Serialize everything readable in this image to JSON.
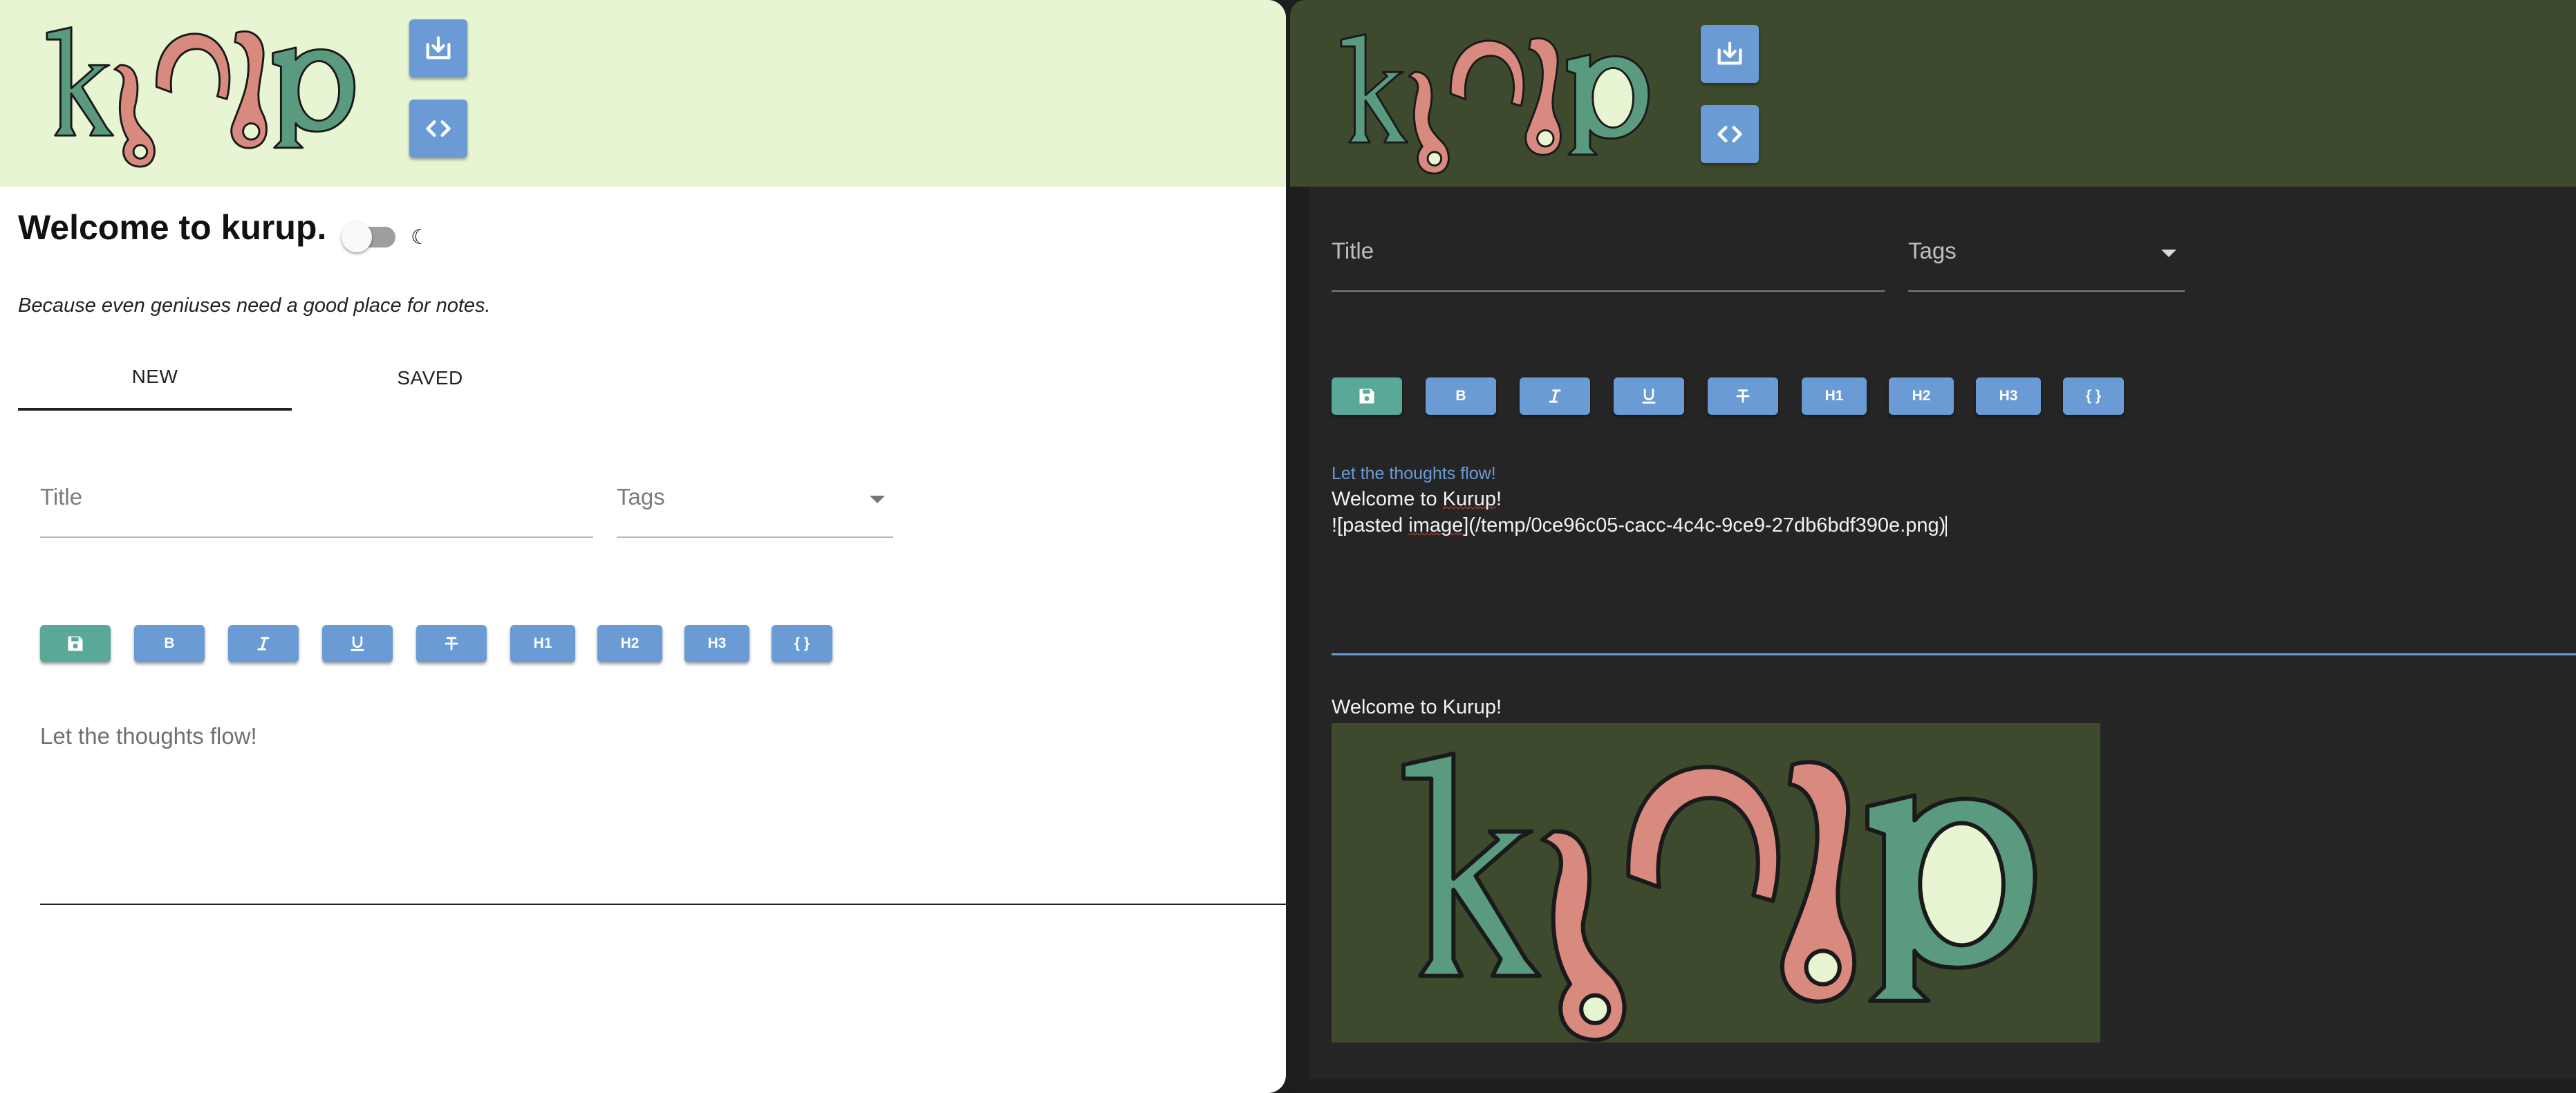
{
  "light": {
    "header": {
      "logo_alt": "kurup",
      "download_button_icon": "download-icon",
      "code_button_icon": "code-brackets-icon"
    },
    "welcome": "Welcome to kurup.",
    "theme_toggle": {
      "state": "off",
      "icon": "moon-icon"
    },
    "tagline": "Because even geniuses need a good place for notes.",
    "tabs": [
      {
        "label": "NEW",
        "active": true
      },
      {
        "label": "SAVED",
        "active": false
      }
    ],
    "fields": {
      "title_placeholder": "Title",
      "tags_placeholder": "Tags"
    },
    "toolbar": {
      "save_icon": "save-icon",
      "bold": "B",
      "italic_icon": "italic-icon",
      "underline_icon": "underline-icon",
      "strike_icon": "strikethrough-icon",
      "h1": "H1",
      "h2": "H2",
      "h3": "H3",
      "code": "{ }"
    },
    "editor_placeholder": "Let the thoughts flow!"
  },
  "dark": {
    "fields": {
      "title_placeholder": "Title",
      "tags_placeholder": "Tags"
    },
    "toolbar": {
      "bold": "B",
      "h1": "H1",
      "h2": "H2",
      "h3": "H3",
      "code": "{ }"
    },
    "editor_label": "Let the thoughts flow!",
    "editor_line1_prefix": "Welcome to ",
    "editor_line1_word": "Kurup",
    "editor_line1_suffix": "!",
    "editor_line2_prefix": "![pasted ",
    "editor_line2_word": "image",
    "editor_line2_suffix": "](/temp/0ce96c05-cacc-4c4c-9ce9-27db6bdf390e.png)",
    "preview_title": "Welcome to Kurup!"
  },
  "colors": {
    "accent_blue": "#6b9bd4",
    "save_green": "#5aa898",
    "logo_green": "#5a9a7e",
    "logo_pink": "#d98a7e",
    "header_light": "#e8f5d3",
    "header_dark": "#3d4a2e"
  }
}
